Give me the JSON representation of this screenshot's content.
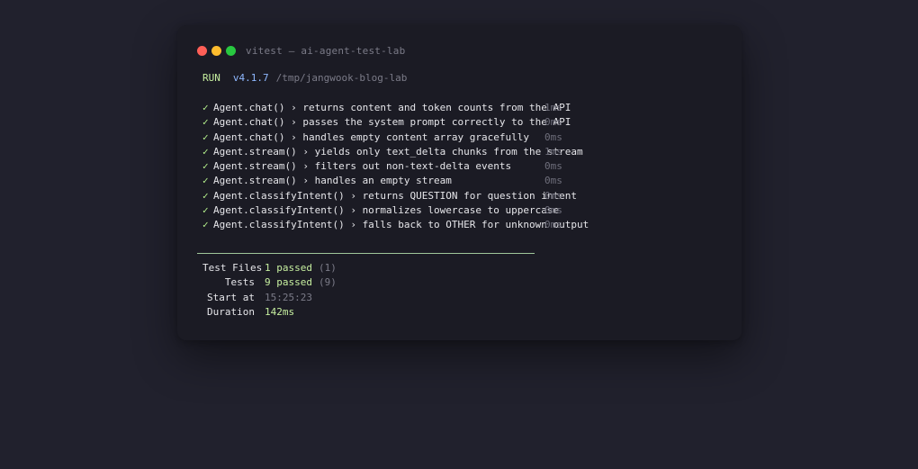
{
  "window": {
    "title": "vitest — ai-agent-test-lab",
    "controls": {
      "close_color": "#ff5f57",
      "minimize_color": "#febc2e",
      "maximize_color": "#28c840"
    }
  },
  "run": {
    "label": "RUN",
    "version": "v4.1.7",
    "path": "/tmp/jangwook-blog-lab"
  },
  "tests": [
    {
      "check": "✓",
      "name": "Agent.chat() › returns content and token counts from the API",
      "time": "1ms"
    },
    {
      "check": "✓",
      "name": "Agent.chat() › passes the system prompt correctly to the API",
      "time": "0ms"
    },
    {
      "check": "✓",
      "name": "Agent.chat() › handles empty content array gracefully",
      "time": "0ms"
    },
    {
      "check": "✓",
      "name": "Agent.stream() › yields only text_delta chunks from the stream",
      "time": "1ms"
    },
    {
      "check": "✓",
      "name": "Agent.stream() › filters out non-text-delta events",
      "time": "0ms"
    },
    {
      "check": "✓",
      "name": "Agent.stream() › handles an empty stream",
      "time": "0ms"
    },
    {
      "check": "✓",
      "name": "Agent.classifyIntent() › returns QUESTION for question intent",
      "time": "0ms"
    },
    {
      "check": "✓",
      "name": "Agent.classifyIntent() › normalizes lowercase to uppercase",
      "time": "0ms"
    },
    {
      "check": "✓",
      "name": "Agent.classifyIntent() › falls back to OTHER for unknown output",
      "time": "0ms"
    }
  ],
  "summary": {
    "test_files": {
      "label": "Test Files",
      "value": "1 passed",
      "count": "(1)"
    },
    "tests": {
      "label": "Tests",
      "value": "9 passed",
      "count": "(9)"
    },
    "start_at": {
      "label": "Start at",
      "value": "15:25:23"
    },
    "duration": {
      "label": "Duration",
      "value": "142ms"
    }
  },
  "colors": {
    "background": "#21212d",
    "terminal": "#1b1b24",
    "pass": "#b4f08c",
    "version": "#8fb8ff",
    "muted": "#7b7b88"
  }
}
